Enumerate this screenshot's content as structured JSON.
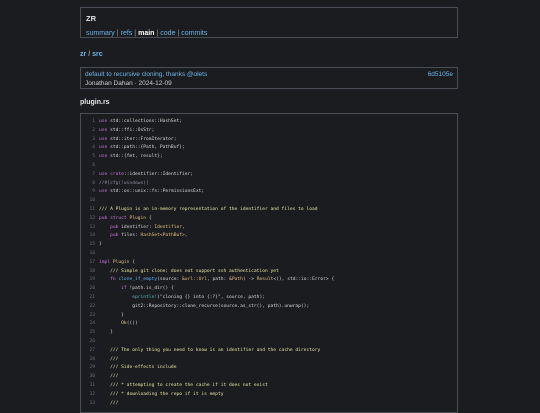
{
  "repo": {
    "name": "ZR"
  },
  "nav": {
    "items": [
      {
        "label": "summary",
        "active": false
      },
      {
        "label": "refs",
        "active": false
      },
      {
        "label": "main",
        "active": true
      },
      {
        "label": "code",
        "active": false
      },
      {
        "label": "commits",
        "active": false
      }
    ]
  },
  "breadcrumb": {
    "root": "zr",
    "sep": "/",
    "dir": "src"
  },
  "commit": {
    "message": "default to recursive cloning, thanks @olets",
    "hash": "6d5105e",
    "author": "Jonathan Dahan",
    "date": "2024-12-09",
    "sep": "·"
  },
  "file": {
    "name": "plugin.rs"
  },
  "code": {
    "lines": [
      [
        [
          "kw",
          "use "
        ],
        [
          "",
          "std::collections::HashSet;"
        ]
      ],
      [
        [
          "kw",
          "use "
        ],
        [
          "",
          "std::ffi::OsStr;"
        ]
      ],
      [
        [
          "kw",
          "use "
        ],
        [
          "",
          "std::iter::FromIterator;"
        ]
      ],
      [
        [
          "kw",
          "use "
        ],
        [
          "",
          "std::path::{Path, PathBuf};"
        ]
      ],
      [
        [
          "kw",
          "use "
        ],
        [
          "",
          "std::{fmt, result};"
        ]
      ],
      [],
      [
        [
          "kw",
          "use "
        ],
        [
          "kw",
          "crate"
        ],
        [
          "",
          "::identifier::Identifier;"
        ]
      ],
      [
        [
          "at",
          "//#[cfg(!windows)]"
        ]
      ],
      [
        [
          "kw",
          "use "
        ],
        [
          "",
          "std::os::unix::fs::PermissionsExt;"
        ]
      ],
      [],
      [
        [
          "cm",
          "/// A Plugin is an in-memory representation of the identifier and files to load"
        ]
      ],
      [
        [
          "kw",
          "pub struct "
        ],
        [
          "ty",
          "Plugin"
        ],
        [
          "",
          " {"
        ]
      ],
      [
        [
          "",
          "    "
        ],
        [
          "kw",
          "pub "
        ],
        [
          "",
          "identifier: "
        ],
        [
          "ty",
          "Identifier"
        ],
        [
          "",
          ","
        ]
      ],
      [
        [
          "",
          "    "
        ],
        [
          "kw",
          "pub "
        ],
        [
          "",
          "files: "
        ],
        [
          "ty",
          "HashSet<PathBuf>"
        ],
        [
          "",
          ","
        ]
      ],
      [
        [
          "",
          "}"
        ]
      ],
      [],
      [
        [
          "kw",
          "impl "
        ],
        [
          "ty",
          "Plugin"
        ],
        [
          "",
          " {"
        ]
      ],
      [
        [
          "",
          "    "
        ],
        [
          "cm",
          "/// Simple git clone; does not support ssh authentication yet"
        ]
      ],
      [
        [
          "",
          "    "
        ],
        [
          "kw",
          "fn "
        ],
        [
          "fn",
          "clone_if_empty"
        ],
        [
          "",
          "(source: "
        ],
        [
          "ty",
          "&url::Url"
        ],
        [
          "",
          ", path: "
        ],
        [
          "ty",
          "&Path"
        ],
        [
          "",
          ") -> "
        ],
        [
          "ty",
          "Result"
        ],
        [
          "",
          "<(), std::io::Error> {"
        ]
      ],
      [
        [
          "",
          "        "
        ],
        [
          "kw",
          "if "
        ],
        [
          "",
          "!path.is_dir() {"
        ]
      ],
      [
        [
          "",
          "            "
        ],
        [
          "mac",
          "eprintln!"
        ],
        [
          "",
          "(\"cloning {} into {:?}\", source, path);"
        ]
      ],
      [
        [
          "",
          "            "
        ],
        [
          "",
          "git2::Repository::clone_recurse(source.as_str(), path).unwrap();"
        ]
      ],
      [
        [
          "",
          "        }"
        ]
      ],
      [
        [
          "",
          "        "
        ],
        [
          "ty",
          "Ok"
        ],
        [
          "",
          "(())"
        ]
      ],
      [
        [
          "",
          "    }"
        ]
      ],
      [],
      [
        [
          "",
          "    "
        ],
        [
          "cm",
          "/// The only thing you need to know is an identifier and the cache directory"
        ]
      ],
      [
        [
          "",
          "    "
        ],
        [
          "cm",
          "///"
        ]
      ],
      [
        [
          "",
          "    "
        ],
        [
          "cm",
          "/// Side-effects include"
        ]
      ],
      [
        [
          "",
          "    "
        ],
        [
          "cm",
          "///"
        ]
      ],
      [
        [
          "",
          "    "
        ],
        [
          "cm",
          "/// * attempting to create the cache if it does not exist"
        ]
      ],
      [
        [
          "",
          "    "
        ],
        [
          "cm",
          "/// * downloading the repo if it is empty"
        ]
      ],
      [
        [
          "",
          "    "
        ],
        [
          "cm",
          "///"
        ]
      ]
    ]
  }
}
